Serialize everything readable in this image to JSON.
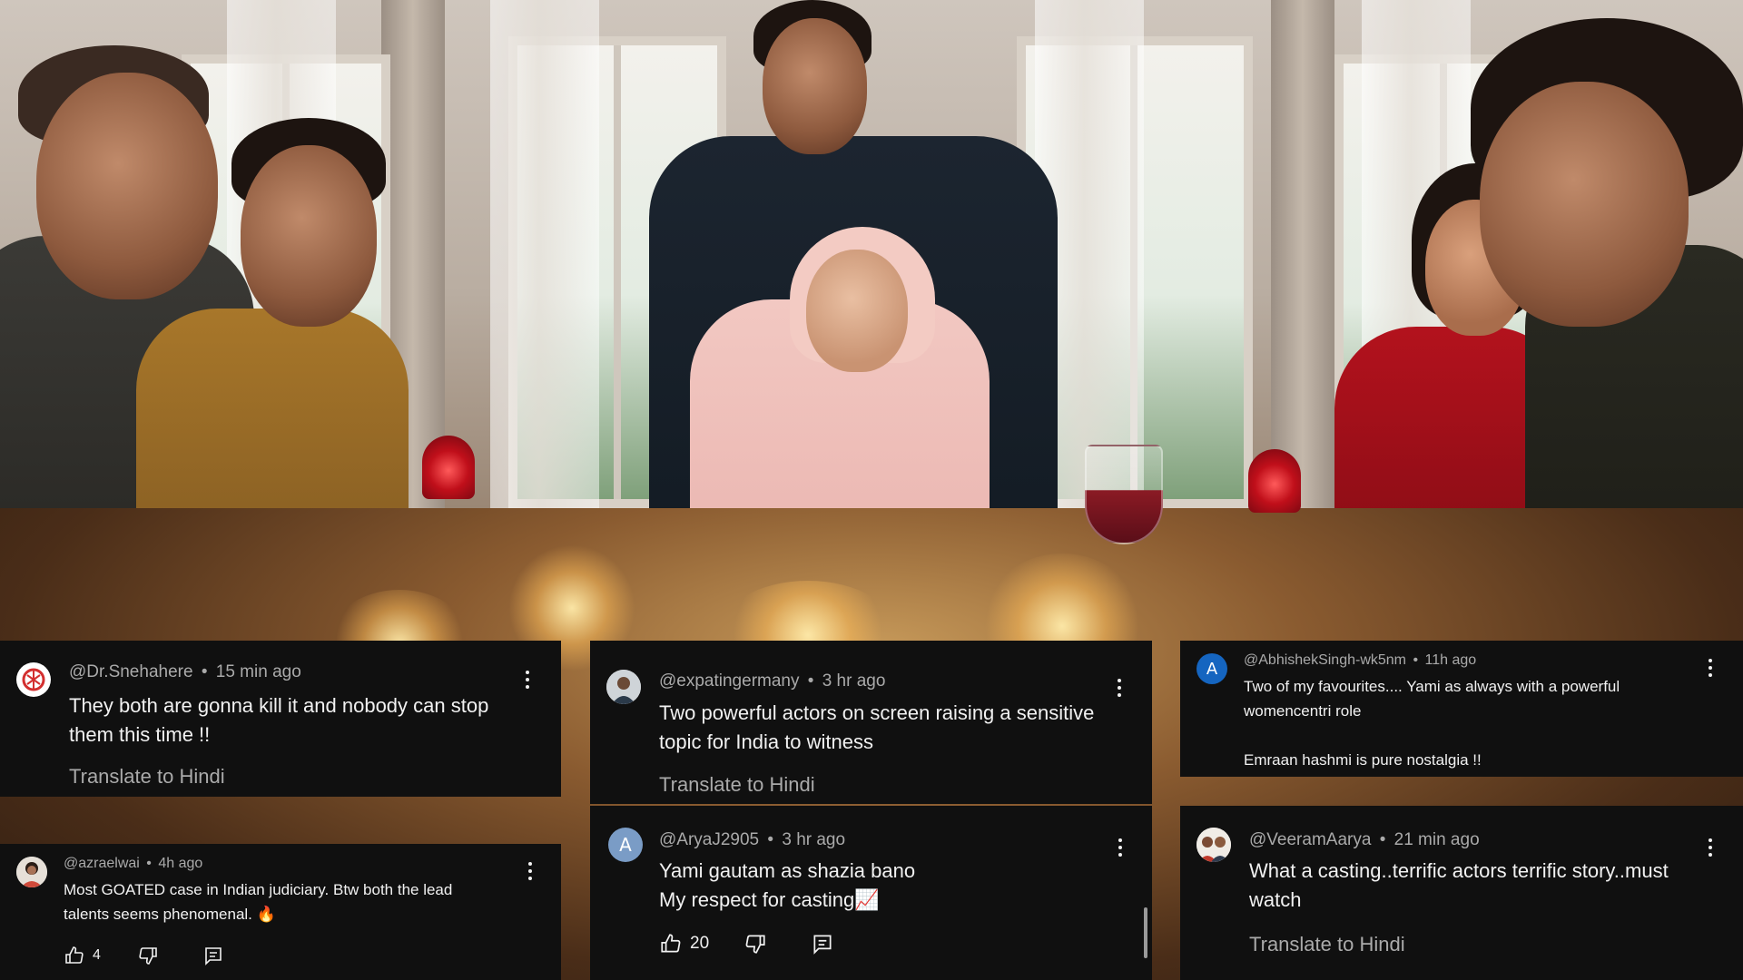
{
  "comments": [
    {
      "handle": "@Dr.Snehahere",
      "time": "15 min ago",
      "text": "They both are gonna kill it and nobody can stop them this time !!",
      "translate": "Translate to Hindi",
      "avatar_color": "#ffffff"
    },
    {
      "handle": "@expatingermany",
      "time": "3 hr ago",
      "text": "Two powerful actors on screen raising a sensitive topic for India to witness",
      "translate": "Translate to Hindi",
      "avatar_color": "#d9d9d9"
    },
    {
      "handle": "@AbhishekSingh-wk5nm",
      "time": "11h ago",
      "text_line1": "Two of my favourites.... Yami as always with a powerful womencentri role",
      "text_line2": "Emraan hashmi is pure nostalgia !!",
      "avatar_letter": "A",
      "avatar_color": "#1565c0"
    },
    {
      "handle": "@azraelwai",
      "time": "4h ago",
      "text": "Most GOATED case in Indian judiciary. Btw both the lead talents seems phenomenal. 🔥",
      "likes": "4",
      "avatar_color": "#e8e8e8"
    },
    {
      "handle": "@AryaJ2905",
      "time": "3 hr ago",
      "text_line1": "Yami gautam as shazia bano",
      "text_line2": "My respect for casting📈",
      "likes": "20",
      "avatar_letter": "A",
      "avatar_color": "#7a9cc6"
    },
    {
      "handle": "@VeeramAarya",
      "time": "21 min ago",
      "text": "What a casting..terrific actors terrific story..must watch",
      "translate": "Translate to Hindi",
      "avatar_color": "#e6e6e6"
    }
  ],
  "separator": "•",
  "icons": {
    "like": "thumbs-up-icon",
    "dislike": "thumbs-down-icon",
    "reply": "reply-icon",
    "menu": "more-vert-icon"
  }
}
